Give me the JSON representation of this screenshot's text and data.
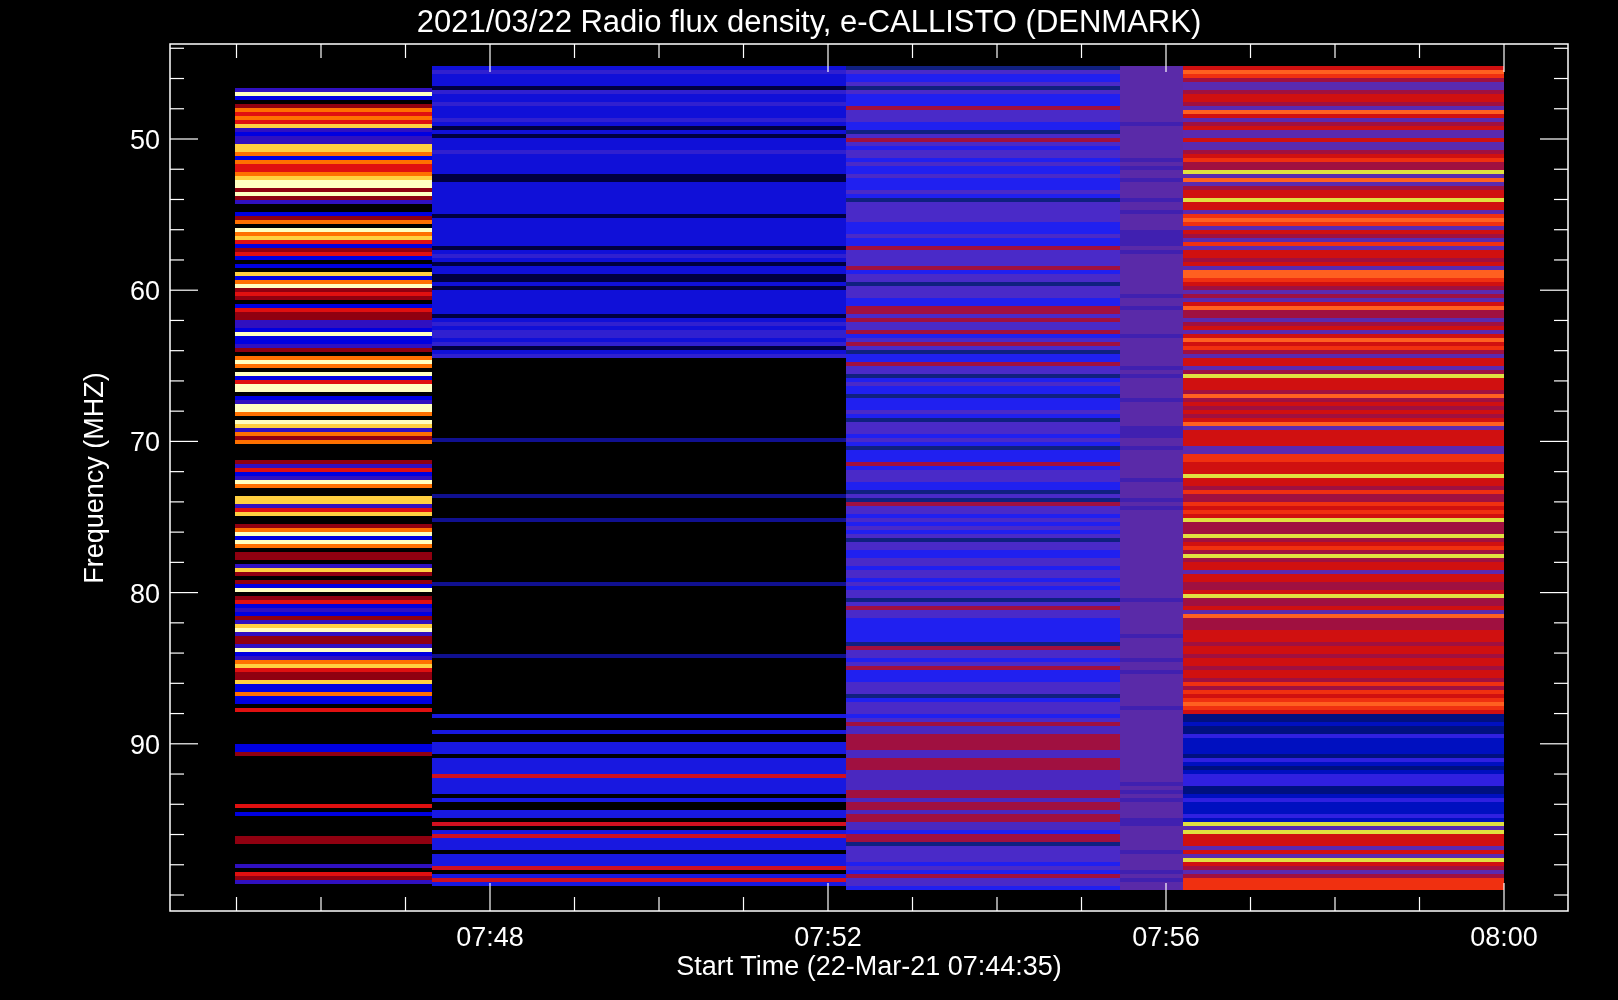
{
  "title": "2021/03/22  Radio flux density, e-CALLISTO (DENMARK)",
  "ylabel": "Frequency (MHZ)",
  "xlabel": "Start Time (22-Mar-21 07:44:35)",
  "yticks": [
    "50",
    "60",
    "70",
    "80",
    "90"
  ],
  "xticks": [
    "07:48",
    "07:52",
    "07:56",
    "08:00"
  ]
}
